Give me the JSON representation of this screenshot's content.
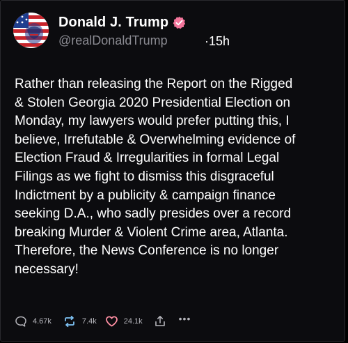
{
  "post": {
    "author": {
      "display_name": "Donald J. Trump",
      "handle": "@realDonaldTrump",
      "verified": true
    },
    "timestamp": "·15h",
    "text": "Rather than releasing the Report on the Rigged\n& Stolen Georgia 2020 Presidential Election on\nMonday, my lawyers would prefer putting this, I\nbelieve, Irrefutable & Overwhelming evidence of\nElection Fraud & Irregularities in formal Legal\nFilings as we fight to dismiss this disgraceful\nIndictment by a publicity & campaign finance\nseeking D.A., who sadly presides over a record\nbreaking Murder & Violent Crime area, Atlanta.\nTherefore, the News Conference is no longer\nnecessary!",
    "actions": {
      "replies": "4.67k",
      "reposts": "7.4k",
      "likes": "24.1k",
      "more": "•••"
    }
  },
  "icons": {
    "reply": "speech-bubble-icon",
    "repost": "repost-arrows-icon",
    "like": "heart-icon",
    "share": "share-upload-icon",
    "more": "more-dots-icon",
    "verified": "verified-badge-icon"
  },
  "colors": {
    "background": "#0c0c0f",
    "verified_badge": "#f4769c",
    "repost_accent": "#7ec2f4",
    "like_accent": "#ff8fa3",
    "muted_text": "#8b8b92"
  }
}
